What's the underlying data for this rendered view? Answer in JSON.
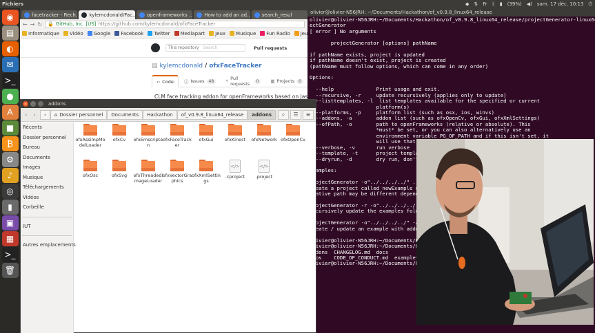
{
  "top_panel": {
    "app_title": "Fichiers",
    "battery": "(39%)",
    "volume_icon": "volume-icon",
    "datetime": "sam. 17 déc.  10:13"
  },
  "launcher": [
    {
      "name": "dash-icon",
      "color": "#e95420",
      "glyph": "◉"
    },
    {
      "name": "files-icon",
      "color": "#9b9080",
      "glyph": "▤"
    },
    {
      "name": "firefox-icon",
      "color": "#e66000",
      "glyph": "◐"
    },
    {
      "name": "thunderbird-icon",
      "color": "#2a6fb5",
      "glyph": "✉"
    },
    {
      "name": "terminal-icon",
      "color": "#222",
      "glyph": ">_"
    },
    {
      "name": "chrome-icon",
      "color": "#4caf50",
      "glyph": "●"
    },
    {
      "name": "software-center-icon",
      "color": "#e0803c",
      "glyph": "A"
    },
    {
      "name": "minecraft-icon",
      "color": "#5b8a3a",
      "glyph": "■"
    },
    {
      "name": "bitcoin-icon",
      "color": "#f7931a",
      "glyph": "₿"
    },
    {
      "name": "settings-icon",
      "color": "#888",
      "glyph": "⚙"
    },
    {
      "name": "rhythmbox-icon",
      "color": "#e0a020",
      "glyph": "♪"
    },
    {
      "name": "cheese-icon",
      "color": "#3a3a3a",
      "glyph": "◎"
    },
    {
      "name": "usb-icon",
      "color": "#6a6a6a",
      "glyph": "▮"
    },
    {
      "name": "screenshot-icon",
      "color": "#7a4caa",
      "glyph": "▣"
    },
    {
      "name": "colors-icon",
      "color": "#c0392b",
      "glyph": "▦"
    },
    {
      "name": "terminal2-icon",
      "color": "#222",
      "glyph": ">_"
    },
    {
      "name": "trash-icon",
      "color": "#555",
      "glyph": "🗑"
    }
  ],
  "browser": {
    "tabs": [
      {
        "label": "facetracker - Rech...",
        "color": "#4285f4"
      },
      {
        "label": "kylemcdonald/Fac...",
        "color": "#24292e"
      },
      {
        "label": "openframeworks ...",
        "color": "#4285f4"
      },
      {
        "label": "How to add an ad...",
        "color": "#4285f4"
      },
      {
        "label": "search_resul",
        "color": "#4285f4"
      }
    ],
    "url_secure": "GitHub, Inc. [US]",
    "url_rest": "https://github.com/kylemcdonald/ofxFaceTracker",
    "bookmarks": [
      {
        "label": "Informatique",
        "color": "#e8b323"
      },
      {
        "label": "Vidéo",
        "color": "#e8b323"
      },
      {
        "label": "Google",
        "color": "#4285f4"
      },
      {
        "label": "Facebook",
        "color": "#3b5998"
      },
      {
        "label": "Twitter",
        "color": "#1da1f2"
      },
      {
        "label": "Mediapart",
        "color": "#c0392b"
      },
      {
        "label": "Jeux",
        "color": "#e8b323"
      },
      {
        "label": "Musique",
        "color": "#e8b323"
      },
      {
        "label": "Fun Radio",
        "color": "#e91e63"
      },
      {
        "label": "JeuxVideo.c",
        "color": "#f39c12"
      }
    ],
    "github": {
      "search_scope": "This repository",
      "search_placeholder": "Search",
      "pull_requests": "Pull requests",
      "owner": "kylemcdonald",
      "separator": "/",
      "repo": "ofxFaceTracker",
      "tabs": [
        {
          "label": "Code",
          "count": ""
        },
        {
          "label": "Issues",
          "count": "48"
        },
        {
          "label": "Pull requests",
          "count": "0"
        },
        {
          "label": "Projects",
          "count": "0"
        }
      ],
      "description": "CLM face tracking addon for openFrameworks based on Jas"
    }
  },
  "file_manager": {
    "title": "addons",
    "breadcrumbs": [
      "Dossier personnel",
      "Documents",
      "Hackathon",
      "of_v0.9.8_linux64_release",
      "addons"
    ],
    "sidebar_top": [
      "Récents",
      "Dossier personnel",
      "Bureau",
      "Documents",
      "Images",
      "Musique",
      "Téléchargements",
      "Vidéos",
      "Corbeille"
    ],
    "sidebar_device": "IUT",
    "sidebar_other": "Autres emplacements",
    "files": [
      {
        "name": "ofxAssimpModelLoader",
        "type": "folder"
      },
      {
        "name": "ofxCv",
        "type": "folder"
      },
      {
        "name": "ofxEmscripten",
        "type": "folder"
      },
      {
        "name": "ofxFaceTracker",
        "type": "folder"
      },
      {
        "name": "ofxGui",
        "type": "folder"
      },
      {
        "name": "ofxKinect",
        "type": "folder"
      },
      {
        "name": "ofxNetwork",
        "type": "folder"
      },
      {
        "name": "ofxOpenCv",
        "type": "folder"
      },
      {
        "name": "ofxOsc",
        "type": "folder"
      },
      {
        "name": "ofxSvg",
        "type": "folder"
      },
      {
        "name": "ofxThreadedImageLoader",
        "type": "folder"
      },
      {
        "name": "ofxVectorGraphics",
        "type": "folder"
      },
      {
        "name": "ofxXmlSettings",
        "type": "folder"
      },
      {
        "name": ".cproject",
        "type": "file"
      },
      {
        "name": ".project",
        "type": "file"
      }
    ]
  },
  "terminal": {
    "title": "olivier@olivier-N56JRH: ~/Documents/Hackathon/of_v0.9.8_linux64_release",
    "lines": [
      "olivier@olivier-N56JRH:~/Documents/Hackathon/of_v0.9.8_linux64_release/projectGenerator-linux64$ proj",
      "ectGenerator",
      "[ error ] No arguments",
      "",
      "       projectGenerator [options] pathName",
      "",
      "if pathName exists, project is updated",
      "if pathName doesn't exist, project is created",
      "(pathName must follow options, which can come in any order)",
      "",
      "Options:",
      "",
      "  --help              Print usage and exit.",
      "  --recursive, -r     update recursively (applies only to update)",
      "  --listtemplates, -l  list templates available for the specified or current",
      "                      platform(s)",
      "  --platforms, -p     platform list (such as osx, ios, winvs)",
      "  --addons, -a        addon list (such as ofxOpenCv, ofxGui, ofxXmlSettings)",
      "  --ofPath, -o        path to openFrameworks (relative or absolute). This",
      "                      *must* be set, or you can also alternatively use an",
      "                      environment variable PG_OF_PATH and if this isn't set, it",
      "                      will use that value instead",
      "  --verbose, -v       run verbose",
      "  --template, -t      project template",
      "  --dryrun, -d        dry run, don't c",
      "",
      "Examples:",
      "",
      "projectGenerator -o\"../../../../\" ../..",
      "create a project called newExample usi",
      "elative path may be different dependin",
      "",
      "projectGenerator -r -o\"../../../../\" ..",
      "recursively update the examples folder",
      "",
      "projectGenerator -o\"../../../../\" -a\"o",
      "create / update an example with addons",
      "",
      "olivier@olivier-N56JRH:~/Documents/Hack",
      "olivier@olivier-N56JRH:~/Documents/Hack",
      "addons  CHANGELOG.md  docs",
      "apps    CODE_OF_CONDUCT.md  examples  I",
      "olivier@olivier-N56JRH:~/Documents/Hack"
    ],
    "right_fragments": [
      "e r",
      "",
      "",
      "",
      "",
      "",
      "",
      "",
      "",
      "",
      "",
      "",
      "ibC",
      "ibC"
    ]
  },
  "webcam": {
    "label": "webcam-feed"
  }
}
